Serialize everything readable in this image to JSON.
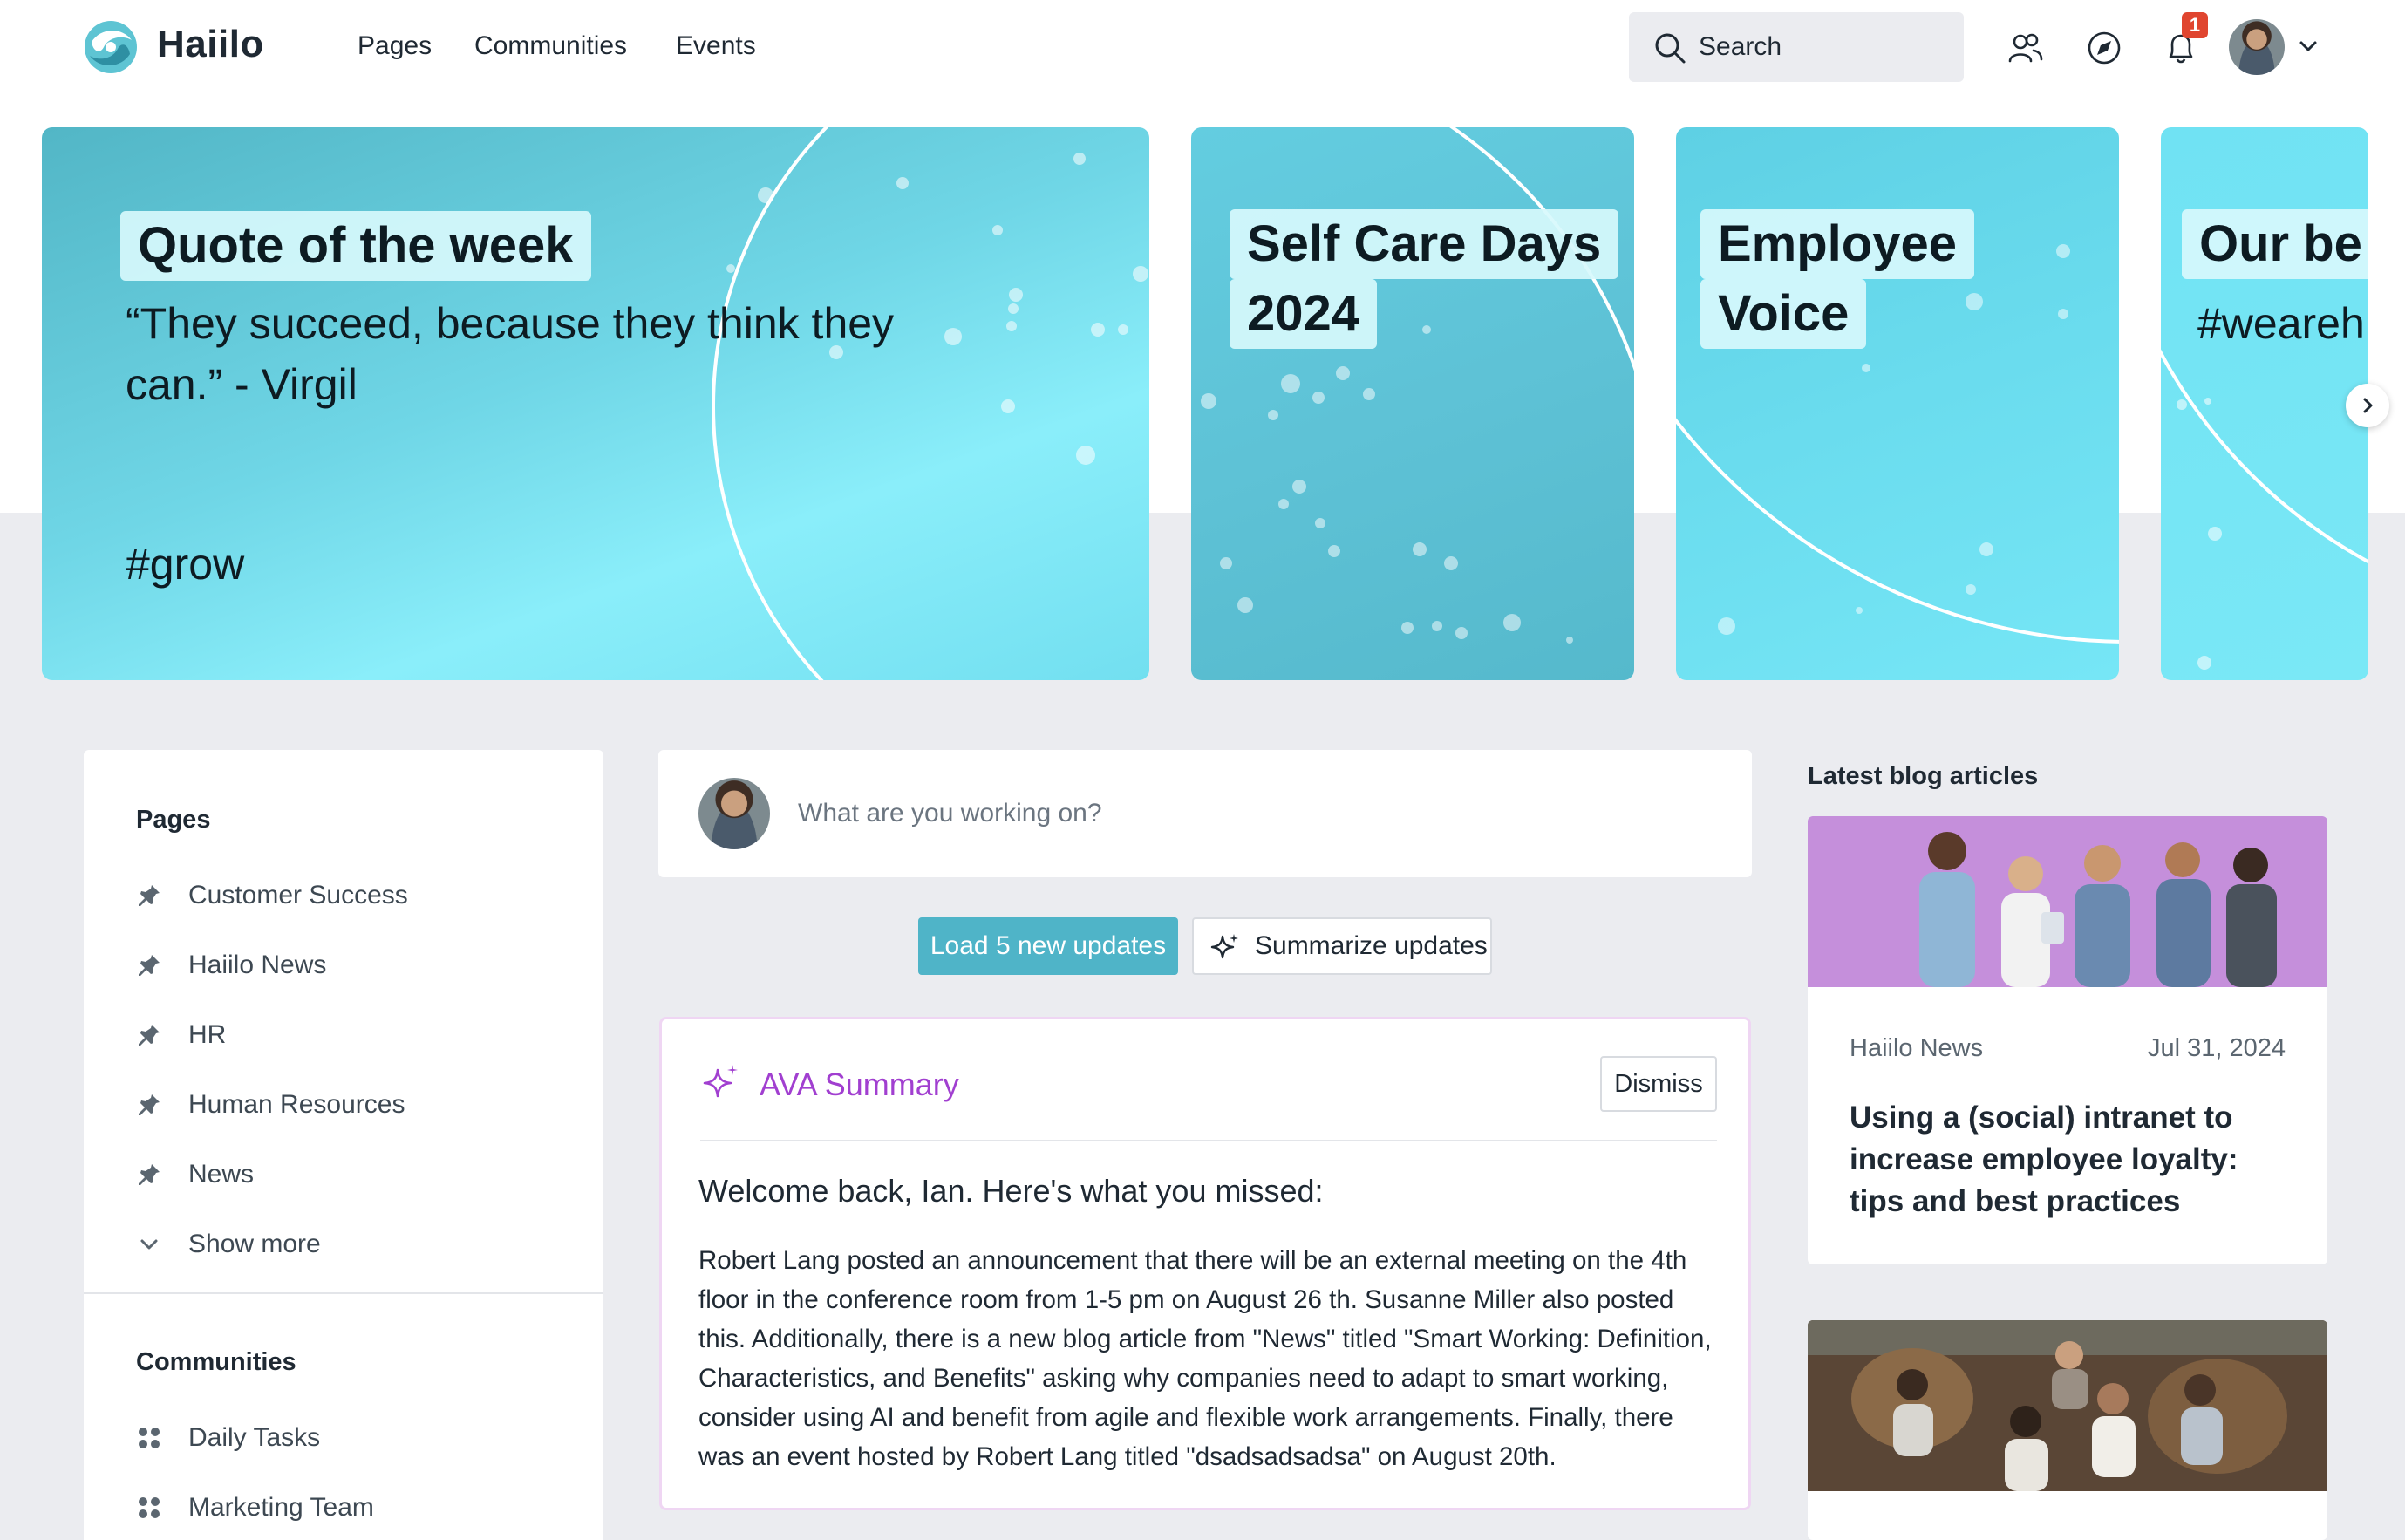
{
  "brand": {
    "name": "Haiilo"
  },
  "nav": {
    "links": [
      "Pages",
      "Communities",
      "Events"
    ],
    "search_placeholder": "Search",
    "notification_count": "1",
    "icons": [
      "people-icon",
      "compass-icon",
      "bell-icon",
      "chevron-down-icon"
    ]
  },
  "hero": {
    "cards": [
      {
        "title": "Quote of the week",
        "quote": "“They succeed, because they think they can.” - Virgil",
        "tag": "#grow"
      },
      {
        "title_line1": "Self Care Days",
        "title_line2": "2024"
      },
      {
        "title_line1": "Employee",
        "title_line2": "Voice"
      },
      {
        "title": "Our be",
        "tag": "#weareh"
      }
    ]
  },
  "sidebar": {
    "pages_title": "Pages",
    "pages": [
      "Customer Success",
      "Haiilo News",
      "HR",
      "Human Resources",
      "News"
    ],
    "show_more": "Show more",
    "communities_title": "Communities",
    "communities": [
      "Daily Tasks",
      "Marketing Team"
    ]
  },
  "feed": {
    "composer_placeholder": "What are you working on?",
    "load_updates_label": "Load 5 new updates",
    "summarize_label": "Summarize updates",
    "ava": {
      "title": "AVA Summary",
      "dismiss_label": "Dismiss",
      "welcome": "Welcome back, Ian. Here's what you missed:",
      "body": "Robert Lang posted an announcement that there will be an external meeting on the 4th floor in the conference room from 1-5 pm on August 26 th. Susanne Miller also posted this. Additionally, there is a new blog article from \"News\" titled \"Smart Working: Definition, Characteristics, and Benefits\" asking why companies need to adapt to smart working, consider using AI and benefit from agile and flexible work arrangements. Finally, there was an event hosted by Robert Lang titled \"dsadsadsadsa\" on August 20th."
    }
  },
  "blog": {
    "section_title": "Latest blog articles",
    "articles": [
      {
        "source": "Haiilo News",
        "date": "Jul 31, 2024",
        "headline": "Using a (social) intranet to increase employee loyalty: tips and best practices"
      }
    ]
  },
  "colors": {
    "accent_teal": "#4fb4c8",
    "ava_purple": "#a13fd0",
    "badge_red": "#e0452f",
    "background_grey": "#ebecf0"
  }
}
